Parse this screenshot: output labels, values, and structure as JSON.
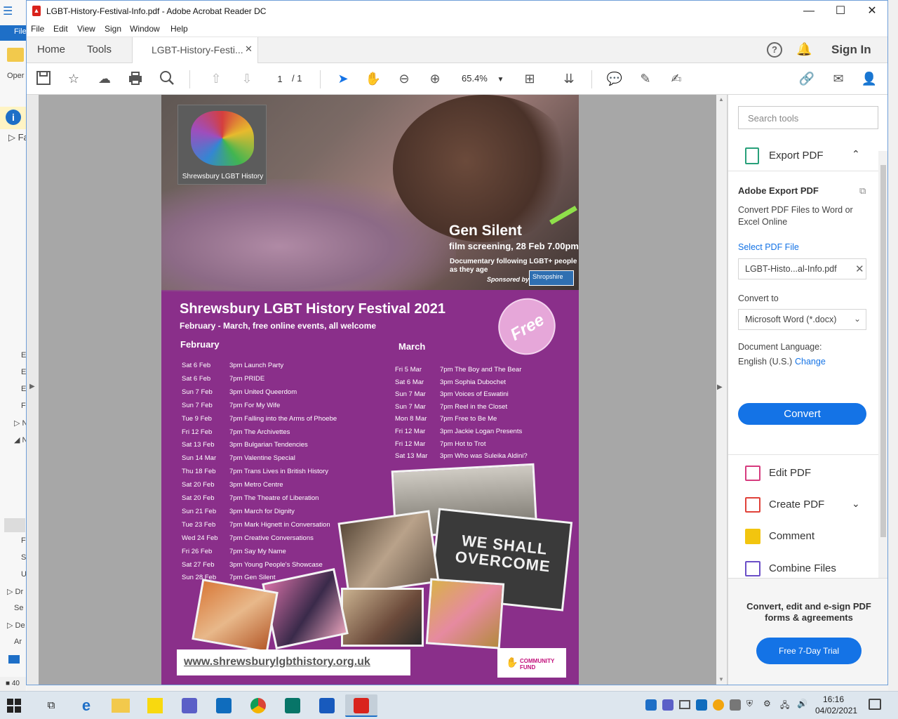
{
  "window": {
    "title": "LGBT-History-Festival-Info.pdf - Adobe Acrobat Reader DC",
    "controls": {
      "minimize": "—",
      "maximize": "☐",
      "close": "✕"
    }
  },
  "background_app": {
    "file_tab": "File",
    "open_label": "Oper",
    "left_labels": [
      "Fa",
      "E",
      "E",
      "E",
      "F",
      "N",
      "N",
      "F",
      "S",
      "U",
      "Dr",
      "Se",
      "De",
      "Ar"
    ],
    "status": "40"
  },
  "menu": [
    "File",
    "Edit",
    "View",
    "Sign",
    "Window",
    "Help"
  ],
  "tabs": {
    "home": "Home",
    "tools": "Tools",
    "document": "LGBT-History-Festi...",
    "close": "✕",
    "sign_in": "Sign In"
  },
  "toolbar": {
    "page_current": "1",
    "page_sep": "/",
    "page_total": "1",
    "zoom": "65.4%"
  },
  "poster": {
    "logo_text": "Shrewsbury LGBT History",
    "film_title": "Gen Silent",
    "film_sub": "film screening, 28 Feb 7.00pm",
    "film_desc": "Documentary following LGBT+ people as they age",
    "sponsored": "Sponsored by:",
    "sponsor": "Shropshire",
    "title": "Shrewsbury LGBT History Festival 2021",
    "subtitle": "February - March, free online events, all welcome",
    "free_badge": "Free",
    "feb_heading": "February",
    "mar_heading": "March",
    "february": [
      {
        "date": "Sat 6 Feb",
        "event": "3pm Launch Party"
      },
      {
        "date": "Sat 6 Feb",
        "event": "7pm PRIDE"
      },
      {
        "date": "Sun 7 Feb",
        "event": "3pm United Queerdom"
      },
      {
        "date": "Sun 7 Feb",
        "event": "7pm For My Wife"
      },
      {
        "date": "Tue 9 Feb",
        "event": "7pm Falling into the Arms of Phoebe"
      },
      {
        "date": "Fri 12 Feb",
        "event": "7pm The Archivettes"
      },
      {
        "date": "Sat 13 Feb",
        "event": "3pm Bulgarian Tendencies"
      },
      {
        "date": "Sun 14 Mar",
        "event": "7pm Valentine Special"
      },
      {
        "date": "Thu 18 Feb",
        "event": "7pm Trans Lives in British History"
      },
      {
        "date": "Sat 20 Feb",
        "event": "3pm Metro Centre"
      },
      {
        "date": "Sat 20 Feb",
        "event": "7pm  The Theatre of Liberation"
      },
      {
        "date": "Sun 21 Feb",
        "event": "3pm March for Dignity"
      },
      {
        "date": "Tue 23 Feb",
        "event": "7pm Mark Hignett in Conversation"
      },
      {
        "date": "Wed 24 Feb",
        "event": "7pm Creative Conversations"
      },
      {
        "date": "Fri 26 Feb",
        "event": "7pm Say My Name"
      },
      {
        "date": "Sat 27 Feb",
        "event": "3pm Young People's Showcase"
      },
      {
        "date": "Sun 28 Feb",
        "event": "7pm Gen Silent"
      }
    ],
    "march": [
      {
        "date": "Fri 5 Mar",
        "event": "7pm The Boy and The Bear"
      },
      {
        "date": "Sat 6 Mar",
        "event": "3pm Sophia Dubochet"
      },
      {
        "date": "Sun 7 Mar",
        "event": "3pm Voices of Eswatini"
      },
      {
        "date": "Sun 7 Mar",
        "event": "7pm Reel in the Closet"
      },
      {
        "date": "Mon 8 Mar",
        "event": "7pm Free to Be Me"
      },
      {
        "date": "Fri 12 Mar",
        "event": "3pm Jackie Logan Presents"
      },
      {
        "date": "Fri 12 Mar",
        "event": "7pm Hot to Trot"
      },
      {
        "date": "Sat 13 Mar",
        "event": "3pm Who was Suleika Aldini?"
      }
    ],
    "collage_text": "WE SHALL OVERCOME",
    "url": "www.shrewsburylgbthistory.org.uk",
    "fund": "COMMUNITY FUND"
  },
  "right_pane": {
    "search_placeholder": "Search tools",
    "export_title": "Export PDF",
    "adobe_export": "Adobe Export PDF",
    "export_desc": "Convert PDF Files to Word or Excel Online",
    "select_file": "Select PDF File",
    "file_name": "LGBT-Histo...al-Info.pdf",
    "convert_to": "Convert to",
    "format": "Microsoft Word (*.docx)",
    "doc_lang_label": "Document Language:",
    "doc_lang": "English (U.S.)",
    "change": "Change",
    "convert_btn": "Convert",
    "tools": [
      "Edit PDF",
      "Create PDF",
      "Comment",
      "Combine Files"
    ],
    "promo": "Convert, edit and e-sign PDF forms & agreements",
    "trial": "Free 7-Day Trial"
  },
  "taskbar": {
    "time": "16:16",
    "date": "04/02/2021"
  },
  "colors": {
    "acrobat_blue": "#1473e6",
    "poster_purple": "#8a2f8a",
    "acrobat_red": "#d9231c"
  }
}
